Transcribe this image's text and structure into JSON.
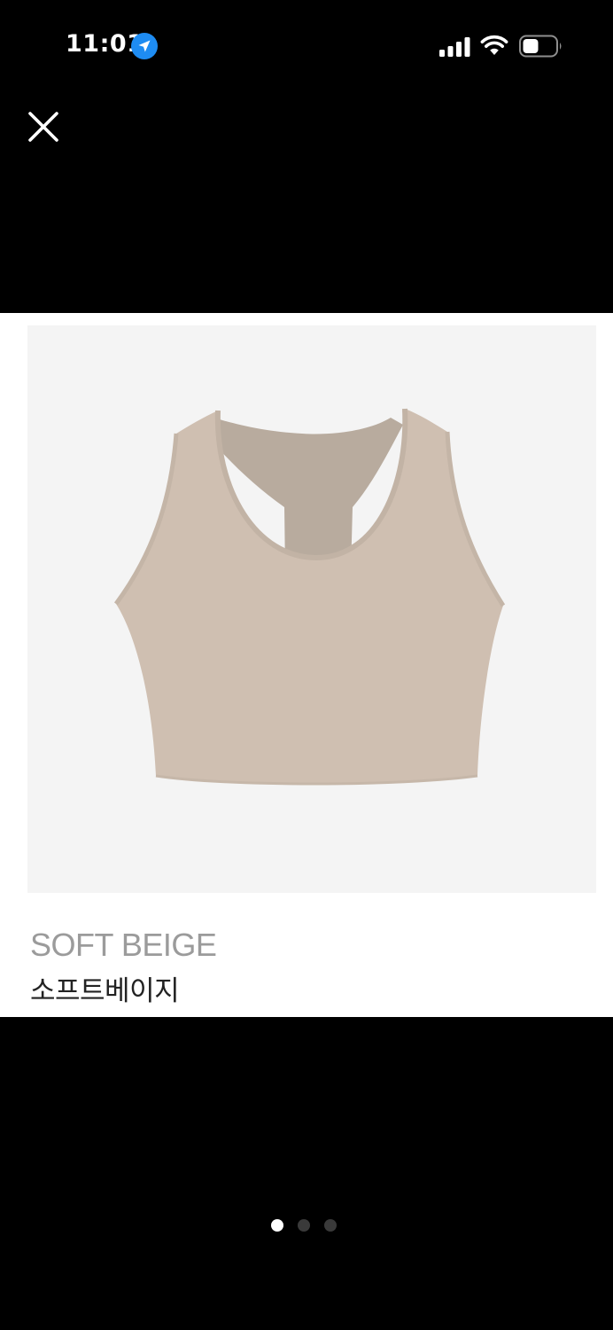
{
  "status_bar": {
    "time": "11:01",
    "icons": [
      "location-arrow-icon",
      "cellular-signal-icon",
      "wifi-icon",
      "battery-icon"
    ]
  },
  "toolbar": {
    "close_icon": "close-icon"
  },
  "product": {
    "image_icon": "sports-bra-image",
    "image_color": "#cfbfb1",
    "color_name_en": "SOFT BEIGE",
    "color_name_ko": "소프트베이지"
  },
  "pager": {
    "total": 3,
    "current": 1,
    "active_color": "#ffffff",
    "inactive_color": "#3a3a3a"
  }
}
